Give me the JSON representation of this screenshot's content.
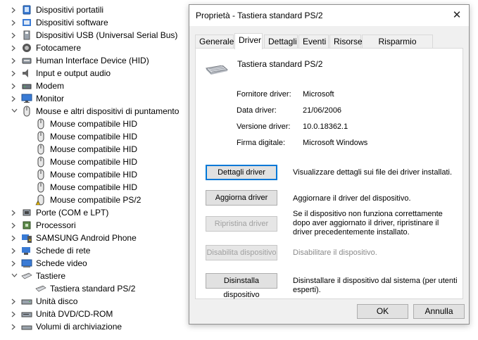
{
  "device_tree": {
    "items": [
      {
        "label": "Dispositivi portatili",
        "level": 0,
        "expanded": false,
        "icon": "portable-device-icon"
      },
      {
        "label": "Dispositivi software",
        "level": 0,
        "expanded": false,
        "icon": "software-device-icon"
      },
      {
        "label": "Dispositivi USB (Universal Serial Bus)",
        "level": 0,
        "expanded": false,
        "icon": "usb-icon"
      },
      {
        "label": "Fotocamere",
        "level": 0,
        "expanded": false,
        "icon": "camera-icon"
      },
      {
        "label": "Human Interface Device (HID)",
        "level": 0,
        "expanded": false,
        "icon": "hid-icon"
      },
      {
        "label": "Input e output audio",
        "level": 0,
        "expanded": false,
        "icon": "speaker-icon"
      },
      {
        "label": "Modem",
        "level": 0,
        "expanded": false,
        "icon": "modem-icon"
      },
      {
        "label": "Monitor",
        "level": 0,
        "expanded": false,
        "icon": "monitor-icon"
      },
      {
        "label": "Mouse e altri dispositivi di puntamento",
        "level": 0,
        "expanded": true,
        "icon": "mouse-icon"
      },
      {
        "label": "Mouse compatibile HID",
        "level": 1,
        "icon": "mouse-icon"
      },
      {
        "label": "Mouse compatibile HID",
        "level": 1,
        "icon": "mouse-icon"
      },
      {
        "label": "Mouse compatibile HID",
        "level": 1,
        "icon": "mouse-icon"
      },
      {
        "label": "Mouse compatibile HID",
        "level": 1,
        "icon": "mouse-icon"
      },
      {
        "label": "Mouse compatibile HID",
        "level": 1,
        "icon": "mouse-icon"
      },
      {
        "label": "Mouse compatibile HID",
        "level": 1,
        "icon": "mouse-icon"
      },
      {
        "label": "Mouse compatibile PS/2",
        "level": 1,
        "icon": "mouse-warning-icon"
      },
      {
        "label": "Porte (COM e LPT)",
        "level": 0,
        "expanded": false,
        "icon": "port-icon"
      },
      {
        "label": "Processori",
        "level": 0,
        "expanded": false,
        "icon": "processor-icon"
      },
      {
        "label": "SAMSUNG Android Phone",
        "level": 0,
        "expanded": false,
        "icon": "phone-icon"
      },
      {
        "label": "Schede di rete",
        "level": 0,
        "expanded": false,
        "icon": "network-adapter-icon"
      },
      {
        "label": "Schede video",
        "level": 0,
        "expanded": false,
        "icon": "display-adapter-icon"
      },
      {
        "label": "Tastiere",
        "level": 0,
        "expanded": true,
        "icon": "keyboard-icon"
      },
      {
        "label": "Tastiera standard PS/2",
        "level": 1,
        "icon": "keyboard-icon"
      },
      {
        "label": "Unità disco",
        "level": 0,
        "expanded": false,
        "icon": "disk-drive-icon"
      },
      {
        "label": "Unità DVD/CD-ROM",
        "level": 0,
        "expanded": false,
        "icon": "dvd-icon"
      },
      {
        "label": "Volumi di archiviazione",
        "level": 0,
        "expanded": false,
        "icon": "storage-volume-icon"
      }
    ]
  },
  "dialog": {
    "title": "Proprietà - Tastiera standard PS/2",
    "tabs": [
      {
        "label": "Generale",
        "active": false
      },
      {
        "label": "Driver",
        "active": true
      },
      {
        "label": "Dettagli",
        "active": false
      },
      {
        "label": "Eventi",
        "active": false
      },
      {
        "label": "Risorse",
        "active": false
      },
      {
        "label": "Risparmio energia",
        "active": false
      }
    ],
    "device_name": "Tastiera standard PS/2",
    "info": [
      {
        "label": "Fornitore driver:",
        "value": "Microsoft"
      },
      {
        "label": "Data driver:",
        "value": "21/06/2006"
      },
      {
        "label": "Versione driver:",
        "value": "10.0.18362.1"
      },
      {
        "label": "Firma digitale:",
        "value": "Microsoft Windows"
      }
    ],
    "actions": [
      {
        "button": "Dettagli driver",
        "description": "Visualizzare dettagli sui file dei driver installati.",
        "enabled": true,
        "focused": true
      },
      {
        "button": "Aggiorna driver",
        "description": "Aggiornare il driver del dispositivo.",
        "enabled": true,
        "focused": false
      },
      {
        "button": "Ripristina driver",
        "description": "Se il dispositivo non funziona correttamente dopo aver aggiornato il driver, ripristinare il driver precedentemente installato.",
        "enabled": false,
        "focused": false
      },
      {
        "button": "Disabilita dispositivo",
        "description": "Disabilitare il dispositivo.",
        "enabled": false,
        "focused": false
      },
      {
        "button": "Disinstalla dispositivo",
        "description": "Disinstallare il dispositivo dal sistema (per utenti esperti).",
        "enabled": true,
        "focused": false
      }
    ],
    "ok_label": "OK",
    "cancel_label": "Annulla",
    "close_glyph": "✕"
  }
}
